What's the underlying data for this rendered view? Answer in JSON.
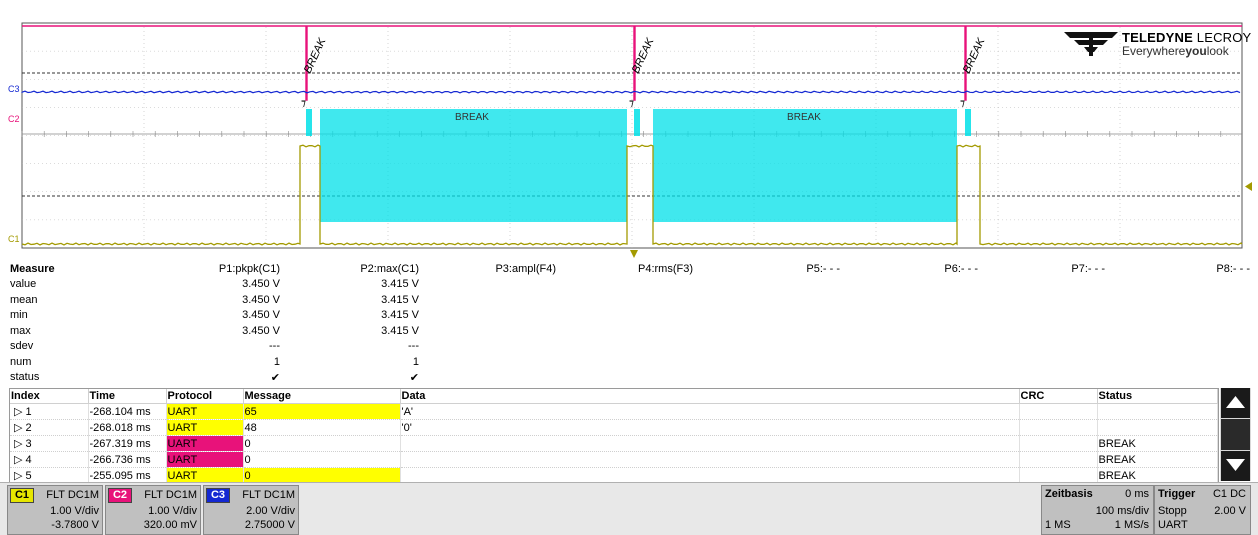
{
  "brand": {
    "name_bold": "TELEDYNE",
    "name_thin": " LECROY",
    "tag_pre": "Everywhere",
    "tag_bold": "you",
    "tag_post": "look"
  },
  "channel_labels": {
    "c1": "C1",
    "c2": "C2",
    "c3": "C3"
  },
  "annotations": {
    "break": "BREAK"
  },
  "colors": {
    "c1": "#a39a00",
    "c2": "#e8127a",
    "c3": "#1428d2",
    "decode": "#00e0e8"
  },
  "measure": {
    "title": "Measure",
    "params": [
      "P1:pkpk(C1)",
      "P2:max(C1)",
      "P3:ampl(F4)",
      "P4:rms(F3)",
      "P5:- - -",
      "P6:- - -",
      "P7:- - -",
      "P8:- - -"
    ],
    "rows": [
      {
        "label": "value",
        "p1": "3.450 V",
        "p2": "3.415 V"
      },
      {
        "label": "mean",
        "p1": "3.450 V",
        "p2": "3.415 V"
      },
      {
        "label": "min",
        "p1": "3.450 V",
        "p2": "3.415 V"
      },
      {
        "label": "max",
        "p1": "3.450 V",
        "p2": "3.415 V"
      },
      {
        "label": "sdev",
        "p1": "---",
        "p2": "---"
      },
      {
        "label": "num",
        "p1": "1",
        "p2": "1"
      },
      {
        "label": "status",
        "p1": "✔",
        "p2": "✔"
      }
    ]
  },
  "decoder": {
    "columns": [
      "Index",
      "Time",
      "Protocol",
      "Message",
      "Data",
      "CRC",
      "Status"
    ],
    "rows": [
      {
        "index": "▷ 1",
        "time": "-268.104 ms",
        "protocol": "UART",
        "message": "65",
        "data": "'A'",
        "crc": "",
        "status": ""
      },
      {
        "index": "▷ 2",
        "time": "-268.018 ms",
        "protocol": "UART",
        "message": "48",
        "data": "'0'",
        "crc": "",
        "status": ""
      },
      {
        "index": "▷ 3",
        "time": "-267.319 ms",
        "protocol": "UART",
        "message": "0",
        "data": "",
        "crc": "",
        "status": "BREAK"
      },
      {
        "index": "▷ 4",
        "time": "-266.736 ms",
        "protocol": "UART",
        "message": "0",
        "data": "",
        "crc": "",
        "status": "BREAK"
      },
      {
        "index": "▷ 5",
        "time": "-255.095 ms",
        "protocol": "UART",
        "message": "0",
        "data": "",
        "crc": "",
        "status": "BREAK"
      }
    ]
  },
  "channels": [
    {
      "tag": "C1",
      "coupling": "FLT  DC1M",
      "vdiv": "1.00 V/div",
      "offset": "-3.7800 V",
      "color": "#ffff00"
    },
    {
      "tag": "C2",
      "coupling": "FLT  DC1M",
      "vdiv": "1.00 V/div",
      "offset": "320.00 mV",
      "color": "#e8127a"
    },
    {
      "tag": "C3",
      "coupling": "FLT  DC1M",
      "vdiv": "2.00 V/div",
      "offset": "2.75000 V",
      "color": "#1428d2"
    }
  ],
  "timebase": {
    "title": "Zeitbasis",
    "delay": "0 ms",
    "tdiv": "100 ms/div",
    "samples": "1 MS",
    "rate": "1 MS/s"
  },
  "trigger": {
    "title": "Trigger",
    "source": "C1 DC",
    "mode": "Stopp",
    "level": "2.00 V",
    "type": "UART"
  }
}
